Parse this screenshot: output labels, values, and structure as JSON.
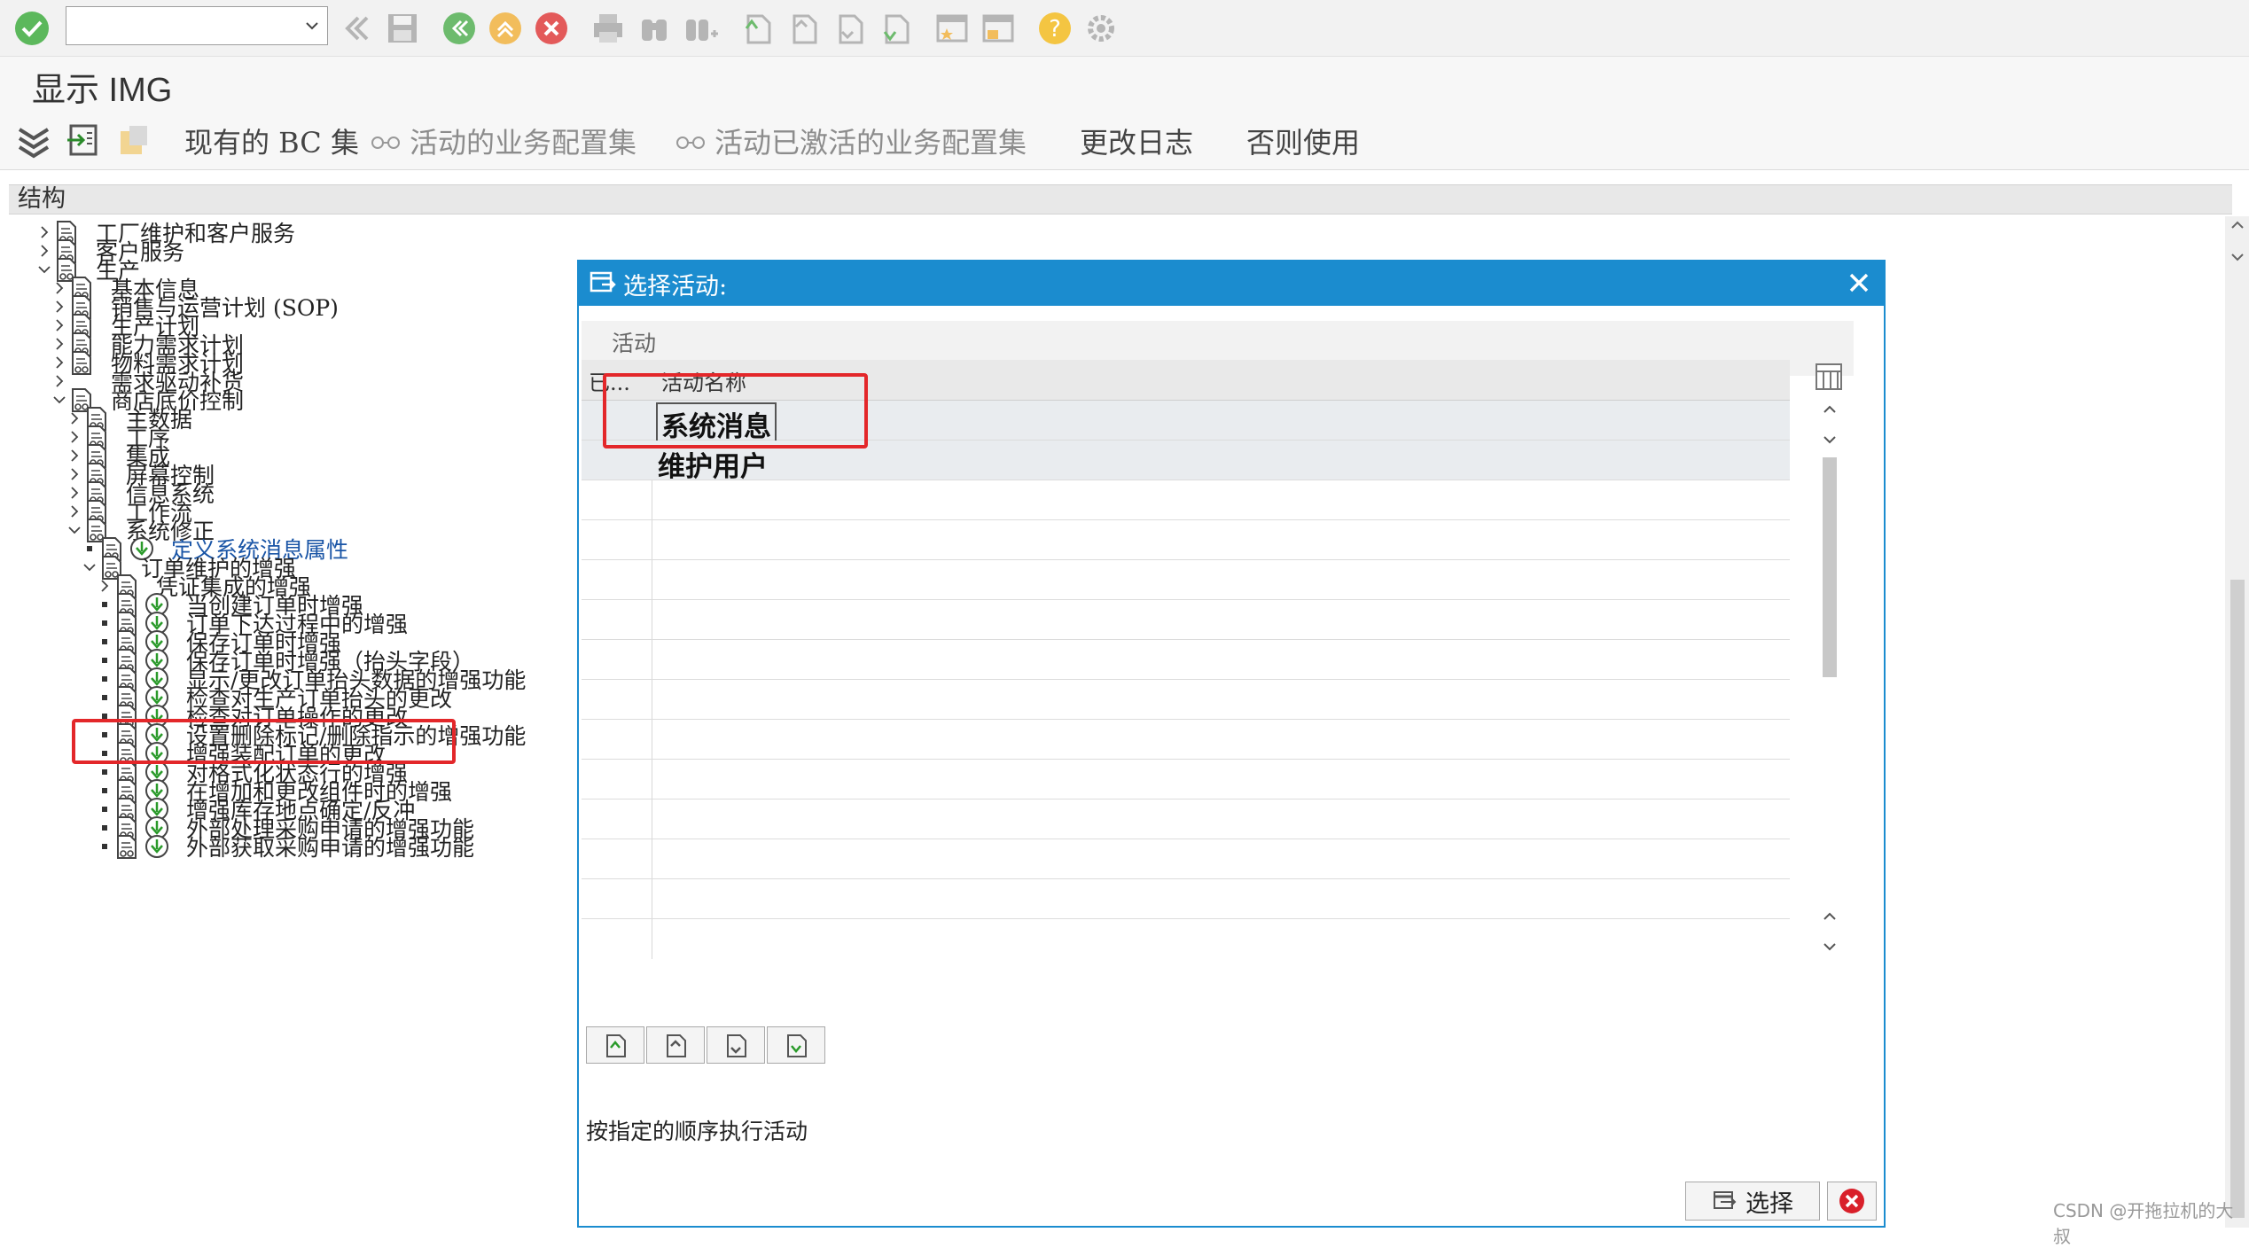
{
  "toolbar": {
    "command_field_value": "",
    "icons": [
      "enter-icon",
      "back-icon",
      "save-icon",
      "back-green-icon",
      "exit-icon",
      "cancel-icon",
      "print-icon",
      "find-icon",
      "find-next-icon",
      "first-page-icon",
      "previous-page-icon",
      "next-page-icon",
      "last-page-icon",
      "create-session-icon",
      "shortcut-icon",
      "help-icon",
      "settings-icon"
    ]
  },
  "title": "显示 IMG",
  "app_toolbar": {
    "existing_bc": "现有的 BC 集",
    "active_bc": "活动的业务配置集",
    "activated_bc": "活动已激活的业务配置集",
    "change_log": "更改日志",
    "where_used": "否则使用"
  },
  "structure": {
    "header": "结构",
    "nodes": [
      {
        "label": "工厂维护和客户服务"
      },
      {
        "label": "客户服务"
      },
      {
        "label": "生产"
      },
      {
        "label": "基本信息"
      },
      {
        "label": "销售与运营计划 (SOP)"
      },
      {
        "label": "生产计划"
      },
      {
        "label": "能力需求计划"
      },
      {
        "label": "物料需求计划"
      },
      {
        "label": "需求驱动补货"
      },
      {
        "label": "商店底价控制"
      },
      {
        "label": "主数据"
      },
      {
        "label": "工序"
      },
      {
        "label": "集成"
      },
      {
        "label": "屏幕控制"
      },
      {
        "label": "信息系统"
      },
      {
        "label": "工作流"
      },
      {
        "label": "系统修正"
      },
      {
        "label": "定义系统消息属性"
      },
      {
        "label": "订单维护的增强"
      },
      {
        "label": "凭证集成的增强"
      },
      {
        "label": "当创建订单时增强"
      },
      {
        "label": "订单下达过程中的增强"
      },
      {
        "label": "保存订单时增强"
      },
      {
        "label": "保存订单时增强（抬头字段）"
      },
      {
        "label": "显示/更改订单抬头数据的增强功能"
      },
      {
        "label": "检查对生产订单抬头的更改"
      },
      {
        "label": "检查对订单操作的更改"
      },
      {
        "label": "设置删除标记/删除指示的增强功能"
      },
      {
        "label": "增强装配订单的更改"
      },
      {
        "label": "对格式化状态行的增强"
      },
      {
        "label": "在增加和更改组件时的增强"
      },
      {
        "label": "增强库存地点确定/反冲"
      },
      {
        "label": "外部处理采购申请的增强功能"
      },
      {
        "label": "外部获取采购申请的增强功能"
      }
    ]
  },
  "dialog": {
    "title": "选择活动:",
    "group_label": "活动",
    "columns": {
      "status": "已...",
      "name": "活动名称"
    },
    "rows": [
      {
        "name": "系统消息"
      },
      {
        "name": "维护用户"
      }
    ],
    "exec_text": "按指定的顺序执行活动",
    "choose_label": "选择"
  },
  "watermark": "CSDN @开拖拉机的大叔"
}
